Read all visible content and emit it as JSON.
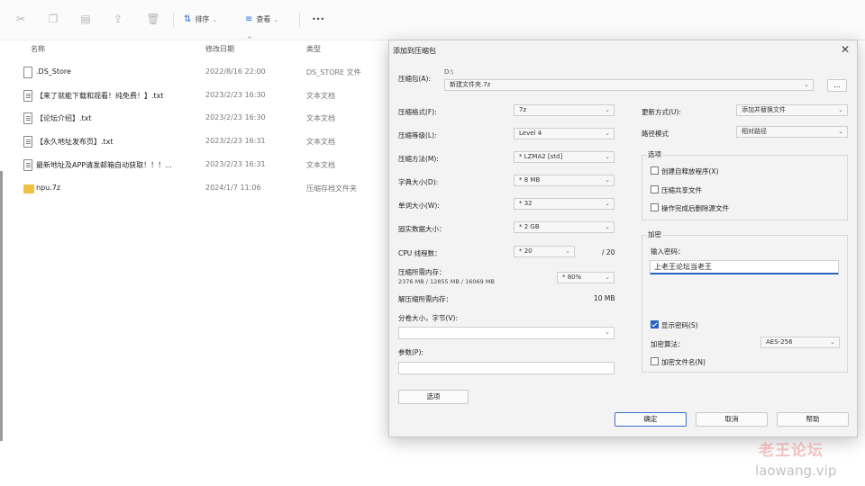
{
  "toolbar": {
    "sort_label": "排序",
    "view_label": "查看",
    "more_label": "•••"
  },
  "columns": {
    "name": "名称",
    "date": "修改日期",
    "type": "类型"
  },
  "files": [
    {
      "name": ".DS_Store",
      "date": "2022/8/16 22:00",
      "type": "DS_STORE 文件",
      "icon": "file-icon"
    },
    {
      "name": "【来了就能下载和观看！纯免费！】.txt",
      "date": "2023/2/23 16:30",
      "type": "文本文档",
      "icon": "txt-icon"
    },
    {
      "name": "【论坛介绍】.txt",
      "date": "2023/2/23 16:30",
      "type": "文本文档",
      "icon": "txt-icon"
    },
    {
      "name": "【永久地址发布页】.txt",
      "date": "2023/2/23 16:31",
      "type": "文本文档",
      "icon": "txt-icon"
    },
    {
      "name": "最新地址及APP请发邮箱自动获取！！！...",
      "date": "2023/2/23 16:31",
      "type": "文本文档",
      "icon": "txt-icon"
    },
    {
      "name": "npu.7z",
      "date": "2024/1/7 11:06",
      "type": "压缩存档文件夹",
      "icon": "folder-icon"
    }
  ],
  "dialog": {
    "title": "添加到压缩包",
    "close": "✕",
    "archive_label": "压缩包(A):",
    "archive_dir": "D:\\",
    "archive_name": "新建文件夹.7z",
    "browse": "...",
    "format_label": "压缩格式(F):",
    "format_value": "7z",
    "level_label": "压缩等级(L):",
    "level_value": "Level 4",
    "method_label": "压缩方法(M):",
    "method_value": "* LZMA2 [std]",
    "dict_label": "字典大小(D):",
    "dict_value": "* 8 MB",
    "word_label": "单词大小(W):",
    "word_value": "* 32",
    "solid_label": "固实数据大小：",
    "solid_value": "* 2 GB",
    "threads_label": "CPU 线程数：",
    "threads_value": "* 20",
    "threads_max": "/ 20",
    "mem_label": "压缩所需内存：",
    "mem_detail": "2376 MB / 12855 MB / 16069 MB",
    "mem_pct": "* 80%",
    "decomp_label": "解压缩所需内存：",
    "decomp_value": "10 MB",
    "split_label": "分卷大小，字节(V):",
    "params_label": "参数(P):",
    "options_button": "选项",
    "update_label": "更新方式(U):",
    "update_value": "添加并替换文件",
    "pathmode_label": "路径模式",
    "pathmode_value": "相对路径",
    "options_group": "选项",
    "opt_sfx": "创建自释放程序(X)",
    "opt_shared": "压缩共享文件",
    "opt_delete": "操作完成后删除源文件",
    "enc_group": "加密",
    "pwd_label": "输入密码：",
    "pwd_value": "上老王论坛当老王",
    "show_pwd": "显示密码(S)",
    "enc_method_label": "加密算法：",
    "enc_method_value": "AES-256",
    "enc_names": "加密文件名(N)",
    "ok": "确定",
    "cancel": "取消",
    "help": "帮助"
  },
  "watermark": {
    "cn": "老王论坛",
    "url": "laowang.vip"
  }
}
